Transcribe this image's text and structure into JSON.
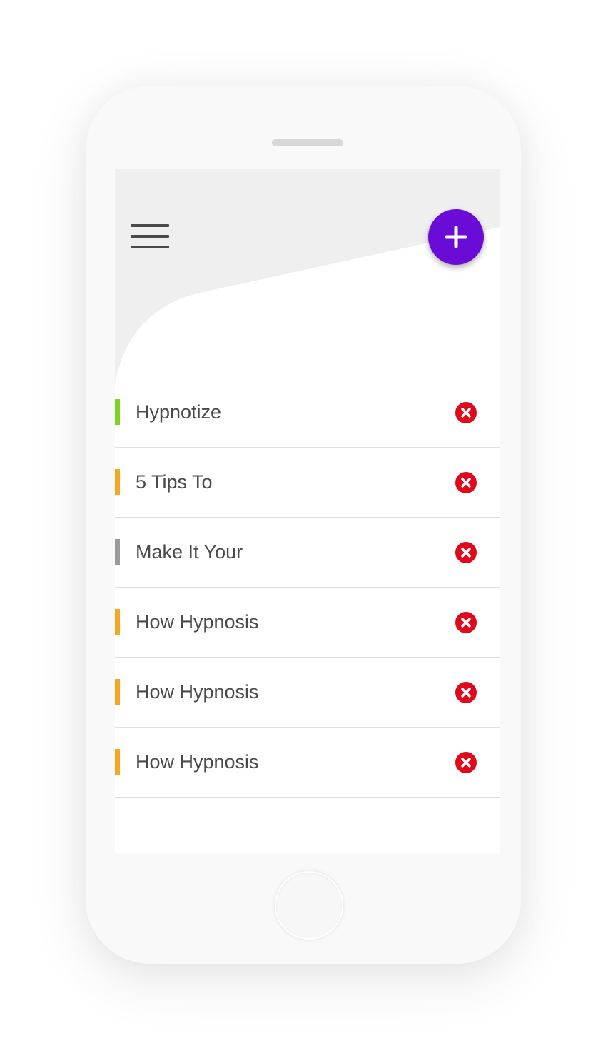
{
  "colors": {
    "accent": "#6b0bd6",
    "delete": "#e0091c",
    "header_background": "#efefef",
    "text": "#4a4a4a",
    "divider": "#e0e0e0"
  },
  "header": {
    "menu_icon": "hamburger-menu-icon",
    "add_icon": "plus-icon"
  },
  "items": [
    {
      "title": "Hypnotize",
      "status_color": "#7ed321",
      "delete_icon": "close-circle-icon"
    },
    {
      "title": "5 Tips To",
      "status_color": "#f5a623",
      "delete_icon": "close-circle-icon"
    },
    {
      "title": "Make It Your",
      "status_color": "#9b9b9b",
      "delete_icon": "close-circle-icon"
    },
    {
      "title": "How Hypnosis",
      "status_color": "#f5a623",
      "delete_icon": "close-circle-icon"
    },
    {
      "title": "How Hypnosis",
      "status_color": "#f5a623",
      "delete_icon": "close-circle-icon"
    },
    {
      "title": "How Hypnosis",
      "status_color": "#f5a623",
      "delete_icon": "close-circle-icon"
    }
  ]
}
